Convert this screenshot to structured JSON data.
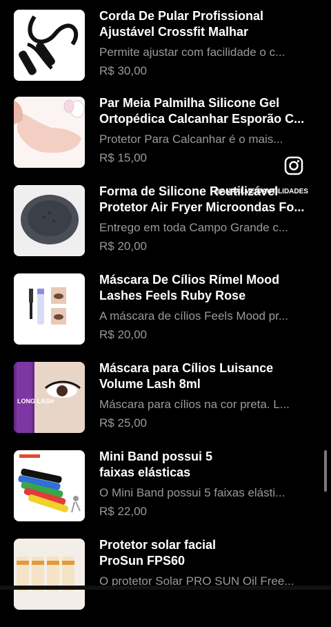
{
  "products": [
    {
      "title_line1": "Corda De Pular Profissional",
      "title_line2": "Ajustável Crossfit Malhar",
      "description": "Permite ajustar com facilidade o c...",
      "price": "R$ 30,00",
      "thumb_icon": "jump-rope-image"
    },
    {
      "title_line1": "Par Meia Palmilha Silicone Gel",
      "title_line2": "Ortopédica Calcanhar Esporão C...",
      "description": "Protetor Para Calcanhar é o mais...",
      "price": "R$ 15,00",
      "thumb_icon": "heel-protector-image"
    },
    {
      "title_line1": "Forma de Silicone Reutilizável",
      "title_line2": "Protetor Air Fryer Microondas Fo...",
      "description": "Entrego em toda Campo Grande c...",
      "price": "R$ 20,00",
      "thumb_icon": "silicone-mold-image"
    },
    {
      "title_line1": "Máscara De Cílios Rímel Mood",
      "title_line2": "Lashes Feels Ruby Rose",
      "description": "A máscara de cílios Feels Mood pr...",
      "price": "R$ 20,00",
      "thumb_icon": "mascara-image"
    },
    {
      "title_line1": "Máscara para Cílios Luisance",
      "title_line2": "Volume Lash 8ml",
      "description": "Máscara para cílios na cor preta. L...",
      "price": "R$ 25,00",
      "thumb_icon": "luisance-mascara-image"
    },
    {
      "title_line1": "Mini Band possui 5",
      "title_line2": "faixas elásticas",
      "description": "O Mini Band possui 5 faixas elásti...",
      "price": "R$ 22,00",
      "thumb_icon": "mini-band-image"
    },
    {
      "title_line1": "Protetor solar facial",
      "title_line2": "ProSun FPS60",
      "description": "O protetor Solar PRO SUN Oil Free...",
      "price": "",
      "thumb_icon": "sunscreen-image"
    }
  ],
  "overlay": {
    "watermark": "@ANAALMEIDAUTILIDADES",
    "icon": "instagram-icon"
  },
  "thumb_text": {
    "long_lash": "LONG LASH"
  }
}
